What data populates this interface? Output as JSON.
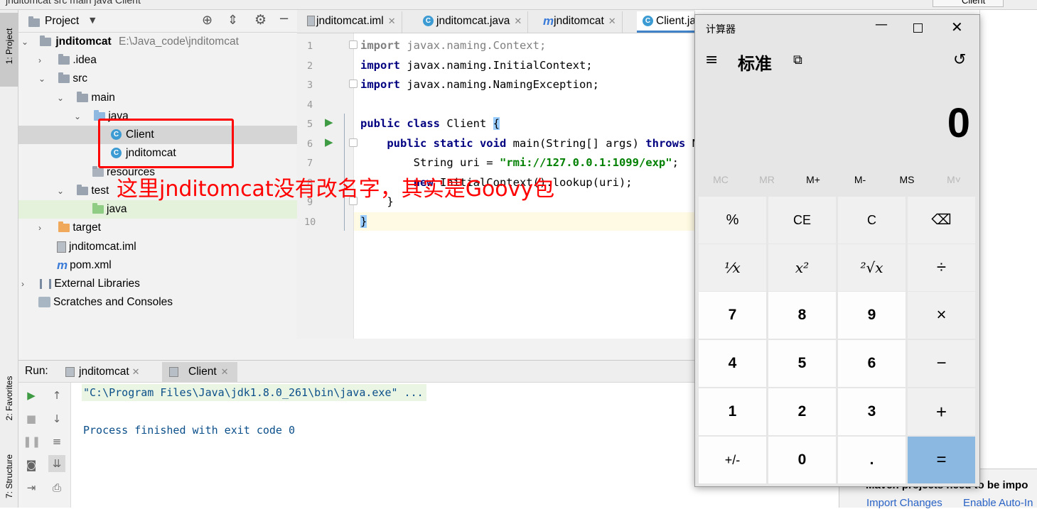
{
  "top_crumbs": {
    "left": "jnditomcat  src  main  java  Client",
    "right": "Client"
  },
  "side_left": {
    "project": "1: Project",
    "favorites": "2: Favorites",
    "structure": "7: Structure"
  },
  "project_panel": {
    "title": "Project",
    "tree": [
      {
        "label": "jnditomcat",
        "path": "E:\\Java_code\\jnditomcat"
      },
      {
        "label": ".idea"
      },
      {
        "label": "src"
      },
      {
        "label": "main"
      },
      {
        "label": "java"
      },
      {
        "label": "Client"
      },
      {
        "label": "jnditomcat"
      },
      {
        "label": "resources"
      },
      {
        "label": "test"
      },
      {
        "label": "java"
      },
      {
        "label": "target"
      },
      {
        "label": "jnditomcat.iml"
      },
      {
        "label": "pom.xml"
      },
      {
        "label": "External Libraries"
      },
      {
        "label": "Scratches and Consoles"
      }
    ]
  },
  "annotation": "这里jnditomcat没有改名字，其实是Goovy包",
  "editor_tabs": [
    "jnditomcat.iml",
    "jnditomcat.java",
    "jnditomcat",
    "Client.ja"
  ],
  "code": {
    "line_numbers": [
      "1",
      "2",
      "3",
      "4",
      "5",
      "6",
      "7",
      "8",
      "9",
      "10"
    ],
    "l1_kw": "import",
    "l1_rest": " javax.naming.Context;",
    "l2_kw": "import",
    "l2_rest": " javax.naming.InitialContext;",
    "l3_kw": "import",
    "l3_rest": " javax.naming.NamingException;",
    "l5_kw": "public class",
    "l5_rest": " Client ",
    "l5_brace": "{",
    "l6_kw1": "    public static void",
    "l6_mid": " main(String[] args) ",
    "l6_kw2": "throws",
    "l6_rest": " Nam",
    "l7_pre": "        String uri = ",
    "l7_str": "\"rmi://127.0.0.1:1099/exp\"",
    "l7_end": ";",
    "l8_kw": "        new",
    "l8_rest": " InitialContext().lookup(uri);",
    "l9": "    }",
    "l10": "}"
  },
  "run_panel": {
    "label": "Run:",
    "tabs": [
      "jnditomcat",
      "Client"
    ],
    "cmd": "\"C:\\Program Files\\Java\\jdk1.8.0_261\\bin\\java.exe\" ...",
    "exit": "Process finished with exit code 0"
  },
  "notification": {
    "title": "Maven projects need to be impo",
    "link1": "Import Changes",
    "link2": "Enable Auto-In"
  },
  "calculator": {
    "title": "计算器",
    "mode": "标准",
    "display": "0",
    "memory": [
      "MC",
      "MR",
      "M+",
      "M-",
      "MS",
      "M˅"
    ],
    "keys": [
      [
        "%",
        "CE",
        "C",
        "⌫"
      ],
      [
        "¹⁄x",
        "x²",
        "²√x",
        "÷"
      ],
      [
        "7",
        "8",
        "9",
        "×"
      ],
      [
        "4",
        "5",
        "6",
        "−"
      ],
      [
        "1",
        "2",
        "3",
        "+"
      ],
      [
        "+/-",
        "0",
        ".",
        "="
      ]
    ]
  },
  "colors": {
    "accent": "#ff0000",
    "calc_equals": "#8bb8e0",
    "ide_select": "#d5d5d5",
    "keyword": "#000080",
    "string": "#008000"
  }
}
